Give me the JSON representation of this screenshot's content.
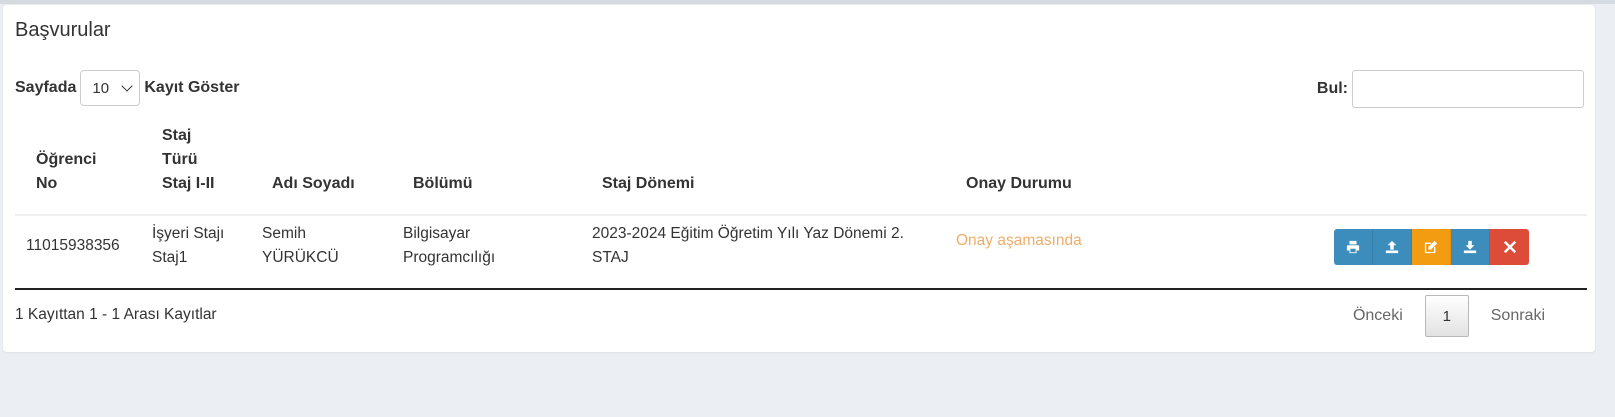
{
  "panel": {
    "title": "Başvurular"
  },
  "length": {
    "prefix": "Sayfada",
    "value": "10",
    "suffix": "Kayıt Göster"
  },
  "search": {
    "label": "Bul:",
    "value": ""
  },
  "table": {
    "headers": {
      "student_no_1": "Öğrenci",
      "student_no_2": "No",
      "type_1": "Staj",
      "type_2": "Türü",
      "type_3": "Staj I-II",
      "name": "Adı Soyadı",
      "dept": "Bölümü",
      "period": "Staj Dönemi",
      "status": "Onay Durumu"
    },
    "rows": [
      {
        "student_no": "11015938356",
        "type_1": "İşyeri Stajı",
        "type_2": "Staj1",
        "name_1": "Semih",
        "name_2": "YÜRÜKCÜ",
        "dept_1": "Bilgisayar",
        "dept_2": "Programcılığı",
        "period_1": "2023-2024 Eğitim Öğretim Yılı Yaz Dönemi 2.",
        "period_2": "STAJ",
        "status": "Onay aşamasında"
      }
    ]
  },
  "actions": [
    {
      "icon": "print-icon",
      "color": "#3c8dbc"
    },
    {
      "icon": "upload-icon",
      "color": "#3c8dbc"
    },
    {
      "icon": "edit-icon",
      "color": "#f39c12"
    },
    {
      "icon": "download-icon",
      "color": "#3c8dbc"
    },
    {
      "icon": "close-icon",
      "color": "#dd4b39"
    }
  ],
  "footer": {
    "info": "1 Kayıttan 1 - 1 Arası Kayıtlar",
    "prev": "Önceki",
    "page": "1",
    "next": "Sonraki"
  },
  "colors": {
    "status_pending": "#f0ad6a",
    "background": "#ebeef2"
  }
}
